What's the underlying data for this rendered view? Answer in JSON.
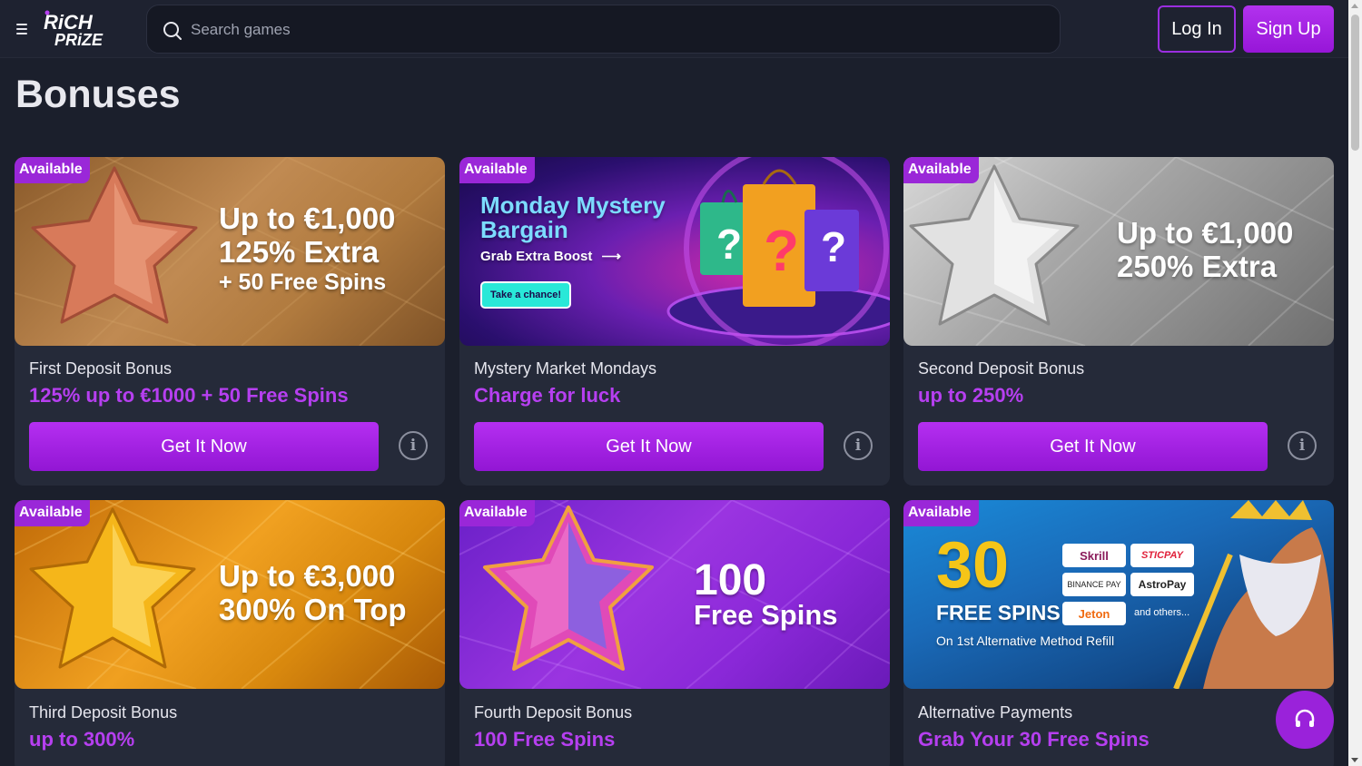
{
  "header": {
    "logo_line1": "RiCH",
    "logo_line2": "PRiZE",
    "search_placeholder": "Search games",
    "login_label": "Log In",
    "signup_label": "Sign Up"
  },
  "page": {
    "title": "Bonuses"
  },
  "cards": [
    {
      "badge": "Available",
      "banner": {
        "line1": "Up to €1,000",
        "line2": "125% Extra",
        "line3": "+ 50 Free Spins"
      },
      "title": "First Deposit Bonus",
      "subtitle": "125% up to €1000 + 50 Free Spins",
      "cta": "Get It Now"
    },
    {
      "badge": "Available",
      "banner": {
        "line1": "Monday Mystery",
        "line2": "Bargain",
        "line3": "Grab Extra Boost",
        "button": "Take a chance!"
      },
      "title": "Mystery Market Mondays",
      "subtitle": "Charge for luck",
      "cta": "Get It Now"
    },
    {
      "badge": "Available",
      "banner": {
        "line1": "Up to €1,000",
        "line2": "250% Extra"
      },
      "title": "Second Deposit Bonus",
      "subtitle": "up to 250%",
      "cta": "Get It Now"
    },
    {
      "badge": "Available",
      "banner": {
        "line1": "Up to €3,000",
        "line2": "300% On Top"
      },
      "title": "Third Deposit Bonus",
      "subtitle": "up to 300%"
    },
    {
      "badge": "Available",
      "banner": {
        "line1": "100",
        "line2": "Free Spins"
      },
      "title": "Fourth Deposit Bonus",
      "subtitle": "100 Free Spins"
    },
    {
      "badge": "Available",
      "banner": {
        "big": "30",
        "line1": "FREE SPINS",
        "line2": "On 1st Alternative Method Refill",
        "methods": [
          "Skrill",
          "STICPAY",
          "BINANCE PAY",
          "AstroPay",
          "Jeton",
          "and others..."
        ]
      },
      "title": "Alternative Payments",
      "subtitle": "Grab Your 30 Free Spins"
    }
  ],
  "colors": {
    "accent": "#9a27d8",
    "background": "#1b1f2c",
    "card": "#252a39"
  }
}
